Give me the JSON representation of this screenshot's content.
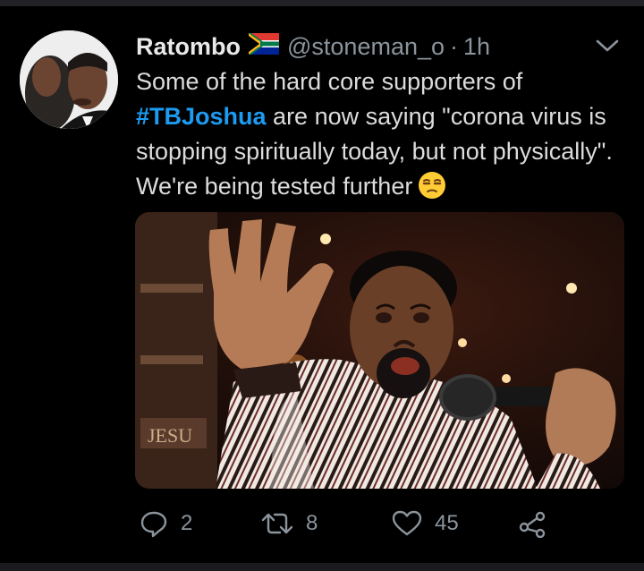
{
  "tweet": {
    "author_name": "Ratombo",
    "handle": "@stoneman_o",
    "separator": "·",
    "time": "1h",
    "text_before": "Some of the hard core supporters of ",
    "hashtag": "#TBJoshua",
    "text_after": " are now saying \"corona virus is stopping spiritually today, but not physically\". We're being tested further",
    "emoji": "unamused-face-icon",
    "media_sign_text": "JESU"
  },
  "actions": {
    "replies": "2",
    "retweets": "8",
    "likes": "45"
  },
  "colors": {
    "background": "#000000",
    "text": "#dcdcdc",
    "secondary": "#8b949c",
    "hashtag": "#1d9bf0"
  },
  "icons": {
    "reply": "reply-icon",
    "retweet": "retweet-icon",
    "like": "heart-icon",
    "share": "share-icon",
    "menu": "chevron-down-icon",
    "flag": "south-africa-flag-icon"
  }
}
